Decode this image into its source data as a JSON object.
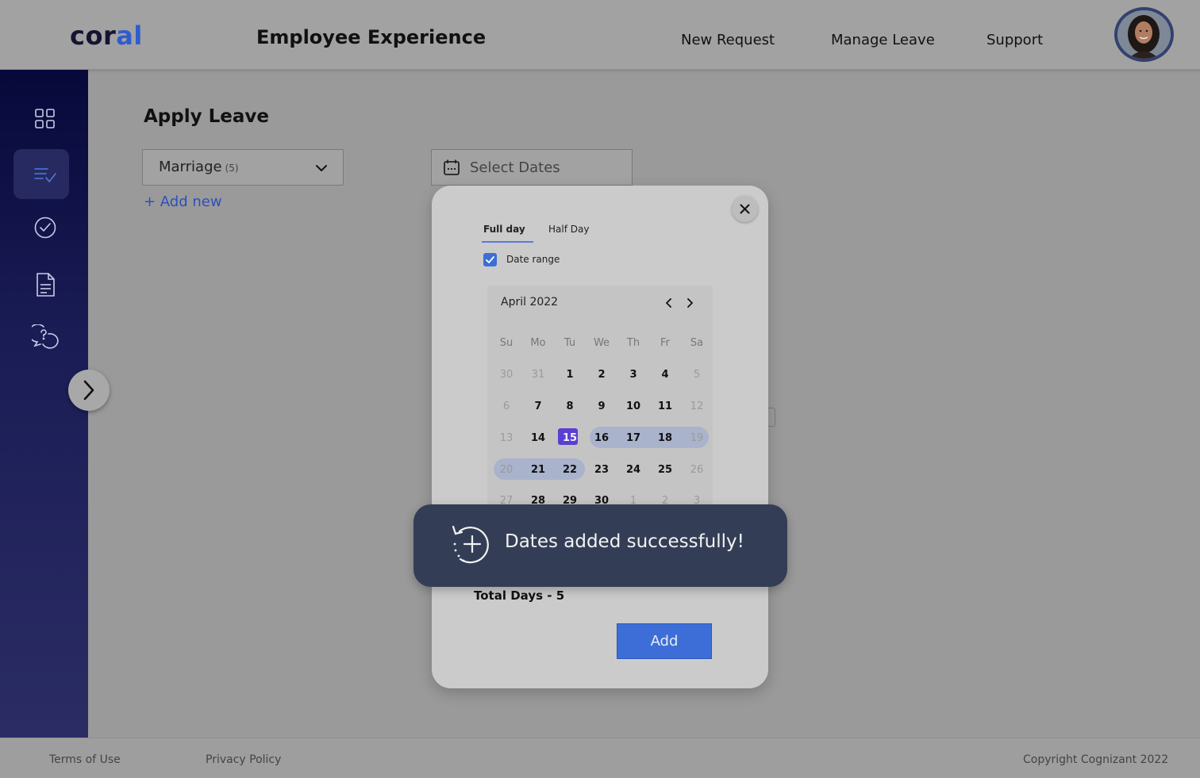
{
  "header": {
    "logo_part1": "cor",
    "logo_part2": "al",
    "title": "Employee Experience",
    "nav": [
      "New Request",
      "Manage Leave",
      "Support"
    ]
  },
  "sidebar": {
    "icons": [
      "dashboard-grid-icon",
      "task-list-icon",
      "check-circle-icon",
      "document-icon",
      "help-chat-icon"
    ],
    "active_index": 1,
    "expand_icon": "chevron-right-icon"
  },
  "main": {
    "title": "Apply Leave",
    "leave_type": {
      "value": "Marriage",
      "count": "(5)"
    },
    "add_new": "+ Add new",
    "date_placeholder": "Select Dates"
  },
  "modal": {
    "tabs": [
      "Full day",
      "Half Day"
    ],
    "active_tab": "Full day",
    "date_range_label": "Date range",
    "date_range_checked": true,
    "calendar": {
      "month": "April 2022",
      "weekdays": [
        "Su",
        "Mo",
        "Tu",
        "We",
        "Th",
        "Fr",
        "Sa"
      ],
      "weeks": [
        [
          "30",
          "31",
          "1",
          "2",
          "3",
          "4",
          "5"
        ],
        [
          "6",
          "7",
          "8",
          "9",
          "10",
          "11",
          "12"
        ],
        [
          "13",
          "14",
          "15",
          "16",
          "17",
          "18",
          "19"
        ],
        [
          "20",
          "21",
          "22",
          "23",
          "24",
          "25",
          "26"
        ],
        [
          "27",
          "28",
          "29",
          "30",
          "1",
          "2",
          "3"
        ]
      ],
      "selected_start": "15",
      "selected_end": "22"
    },
    "total_days": "Total Days - 5",
    "add_button": "Add"
  },
  "toast": {
    "message": "Dates added successfully!",
    "icon": "add-history-icon"
  },
  "footer": {
    "terms": "Terms of Use",
    "privacy": "Privacy Policy",
    "copyright": "Copyright Cognizant 2022"
  },
  "colors": {
    "brand_accent": "#2f5bd0",
    "sidebar_dark": "#07083a",
    "primary_button": "#3d6ed8",
    "selected_day": "#5b3fd0",
    "toast_bg": "#333e56"
  }
}
